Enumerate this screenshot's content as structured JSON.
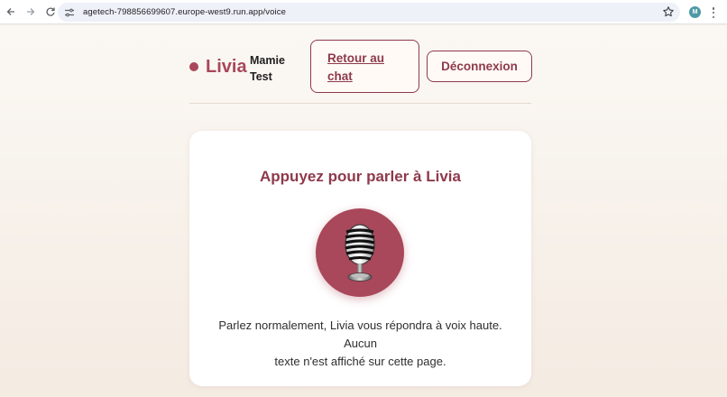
{
  "browser": {
    "url": "agetech-798856699607.europe-west9.run.app/voice",
    "profile_initial": "M"
  },
  "header": {
    "brand": "Livia",
    "user_line1": "Mamie",
    "user_line2": "Test",
    "back_to_chat_line1": "Retour au",
    "back_to_chat_line2": "chat",
    "logout_label": "Déconnexion"
  },
  "card": {
    "title": "Appuyez pour parler à Livia",
    "description_line1": "Parlez normalement, Livia vous répondra à voix haute. Aucun",
    "description_line2": "texte n'est affiché sur cette page."
  },
  "colors": {
    "accent": "#a8485a",
    "accent_dark": "#8e3a4b",
    "background": "#f6efe7"
  },
  "icons": {
    "mic_button": "microphone-icon"
  }
}
